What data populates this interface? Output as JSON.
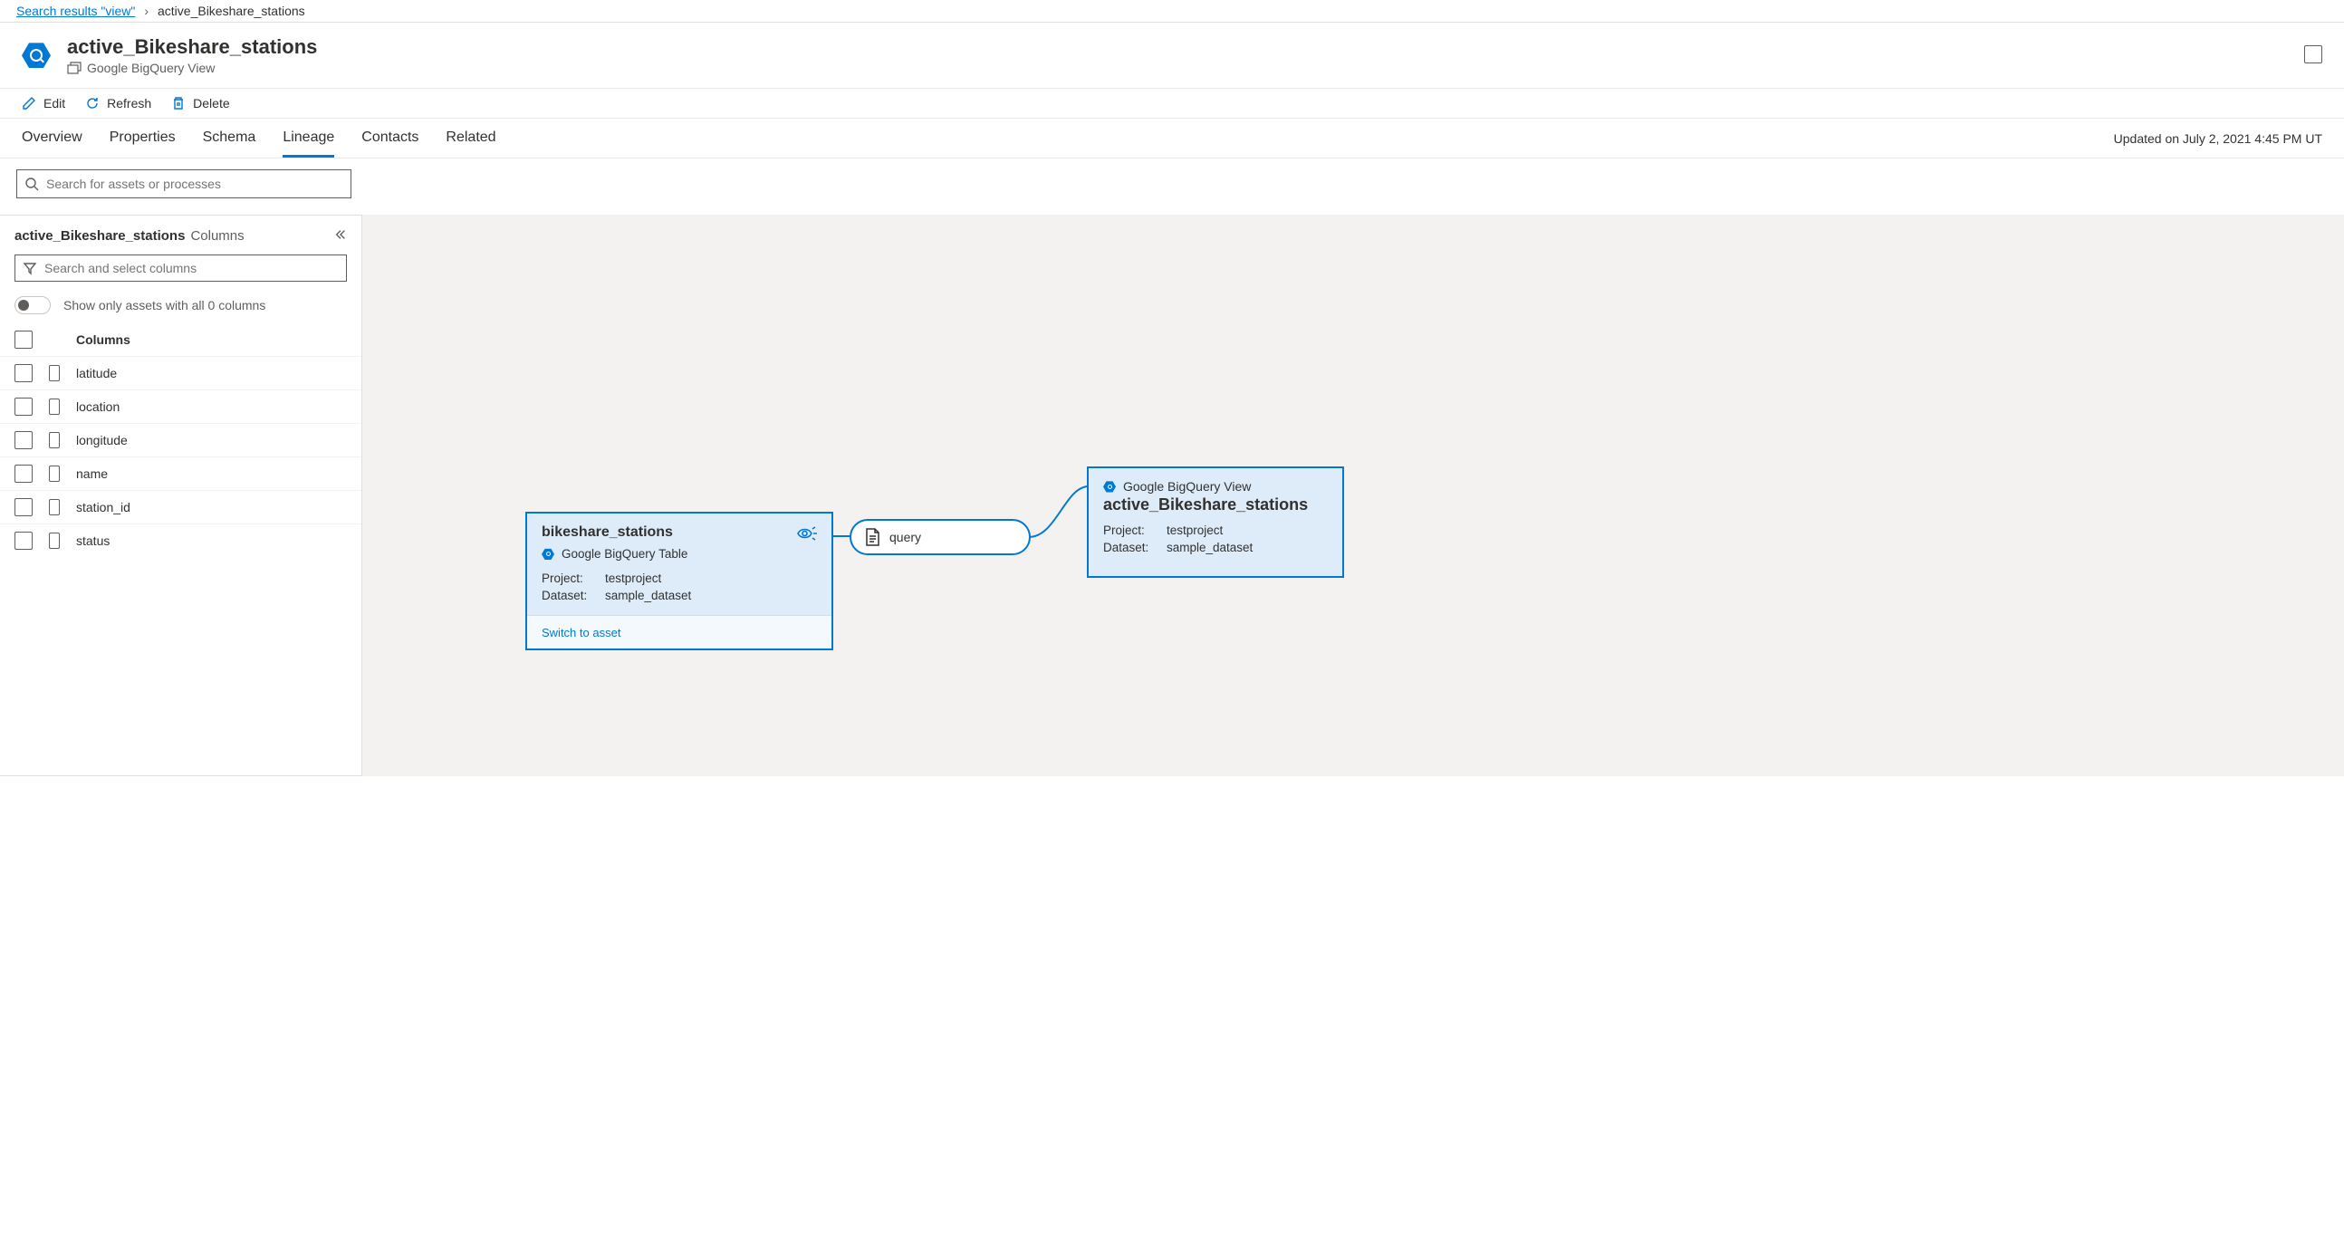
{
  "breadcrumb": {
    "link_label": "Search results \"view\"",
    "current": "active_Bikeshare_stations"
  },
  "header": {
    "title": "active_Bikeshare_stations",
    "type_label": "Google BigQuery View"
  },
  "toolbar": {
    "edit": "Edit",
    "refresh": "Refresh",
    "delete": "Delete"
  },
  "tabs": {
    "overview": "Overview",
    "properties": "Properties",
    "schema": "Schema",
    "lineage": "Lineage",
    "contacts": "Contacts",
    "related": "Related"
  },
  "updated_on": "Updated on July 2, 2021 4:45 PM UT",
  "asset_search_placeholder": "Search for assets or processes",
  "panel": {
    "title": "active_Bikeshare_stations",
    "subtitle": "Columns",
    "col_search_placeholder": "Search and select columns",
    "toggle_label": "Show only assets with all 0 columns",
    "header_label": "Columns",
    "columns": [
      "latitude",
      "location",
      "longitude",
      "name",
      "station_id",
      "status"
    ]
  },
  "lineage": {
    "source": {
      "title": "bikeshare_stations",
      "type": "Google BigQuery Table",
      "project_label": "Project:",
      "project_value": "testproject",
      "dataset_label": "Dataset:",
      "dataset_value": "sample_dataset",
      "switch_label": "Switch to asset"
    },
    "process": {
      "label": "query"
    },
    "target": {
      "type": "Google BigQuery View",
      "title": "active_Bikeshare_stations",
      "project_label": "Project:",
      "project_value": "testproject",
      "dataset_label": "Dataset:",
      "dataset_value": "sample_dataset"
    }
  }
}
